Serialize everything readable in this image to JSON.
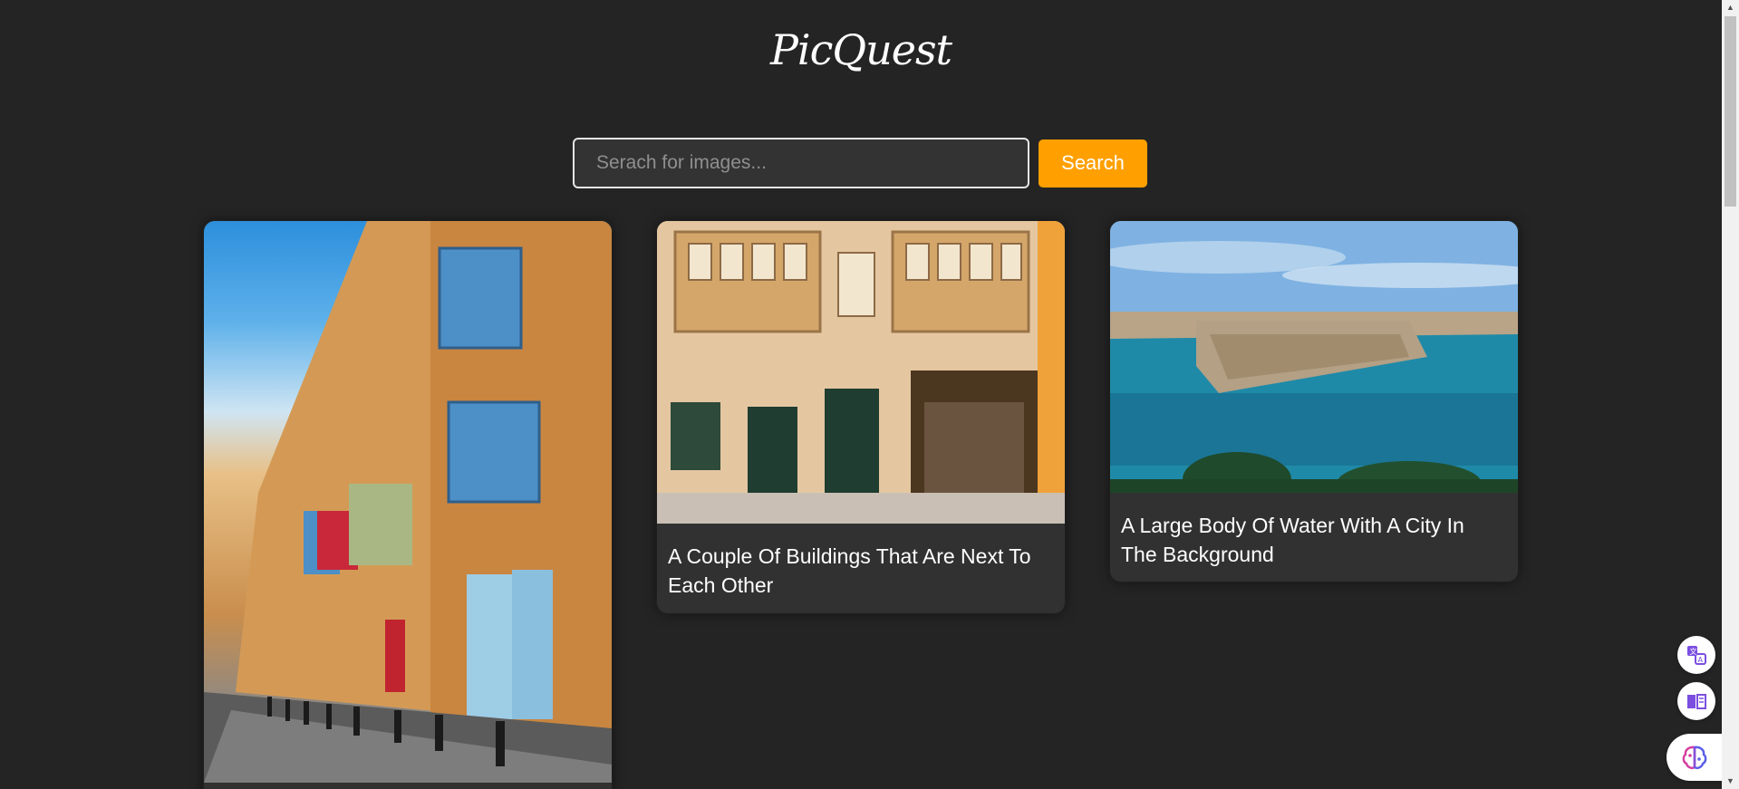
{
  "app": {
    "brand": "PicQuest"
  },
  "search": {
    "placeholder": "Serach for images...",
    "button_label": "Search"
  },
  "results": [
    {
      "image": "street-with-colorful-balconies-photo",
      "caption": ""
    },
    {
      "image": "buildings-with-balconies-photo",
      "caption": "A Couple Of Buildings That Are Next To Each Other"
    },
    {
      "image": "harbor-and-city-photo",
      "caption": "A Large Body Of Water With A City In The Background"
    }
  ],
  "floating_tools": [
    {
      "icon": "translate-icon"
    },
    {
      "icon": "reader-icon"
    },
    {
      "icon": "brain-icon"
    }
  ],
  "colors": {
    "background": "#242424",
    "card": "#313131",
    "accent": "#ffa000",
    "tool_icon": "#7b4ee0"
  }
}
